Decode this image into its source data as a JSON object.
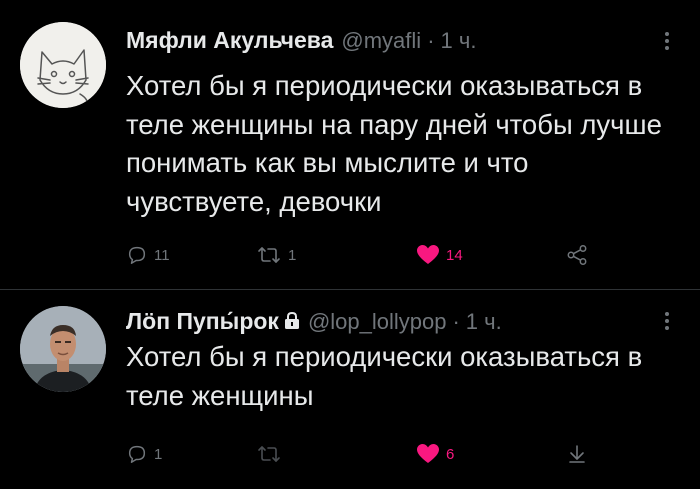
{
  "tweets": [
    {
      "author_name": "Мяфли Акульчева",
      "handle": "@myafli",
      "separator": "·",
      "time": "1 ч.",
      "locked": false,
      "text": "Хотел бы я периодически оказываться в теле женщины на пару дней чтобы лучше понимать как вы мыслите и что чувствуете, девочки",
      "replies": "11",
      "retweets": "1",
      "likes": "14",
      "liked": true,
      "last_action_icon": "share-icon",
      "avatar": "cat-sketch-avatar"
    },
    {
      "author_name": "Лӧп Пупы́рок",
      "handle": "@lop_lollypop",
      "separator": "·",
      "time": "1 ч.",
      "locked": true,
      "text": "Хотел бы я периодически оказываться в теле женщины",
      "replies": "1",
      "retweets": "",
      "likes": "6",
      "liked": true,
      "last_action_icon": "arrow-down-icon",
      "avatar": "man-photo-avatar"
    }
  ],
  "colors": {
    "background": "#000000",
    "text": "#e7e9ea",
    "muted": "#71767b",
    "like": "#f91880",
    "divider": "#2f3336"
  }
}
